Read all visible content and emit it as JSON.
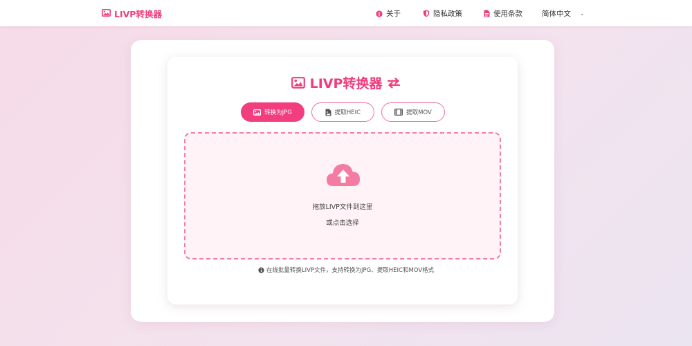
{
  "header": {
    "brand": "LIVP转换器",
    "nav": {
      "about": "关于",
      "privacy": "隐私政策",
      "terms": "使用条款",
      "language": "简体中文"
    }
  },
  "main": {
    "title": "LIVP转换器",
    "tabs": [
      {
        "label": "转换为JPG",
        "icon": "image-icon",
        "active": true
      },
      {
        "label": "提取HEIC",
        "icon": "file-image-icon",
        "active": false
      },
      {
        "label": "提取MOV",
        "icon": "film-icon",
        "active": false
      }
    ],
    "dropzone": {
      "primary_text": "拖放LIVP文件到这里",
      "secondary_text": "或点击选择"
    },
    "info_text": "在线批量转换LIVP文件，支持转换为JPG、提取HEIC和MOV格式"
  },
  "colors": {
    "accent": "#f03c7c",
    "dropzone_bg": "#fff3f7",
    "dropzone_border": "#f27da6"
  }
}
